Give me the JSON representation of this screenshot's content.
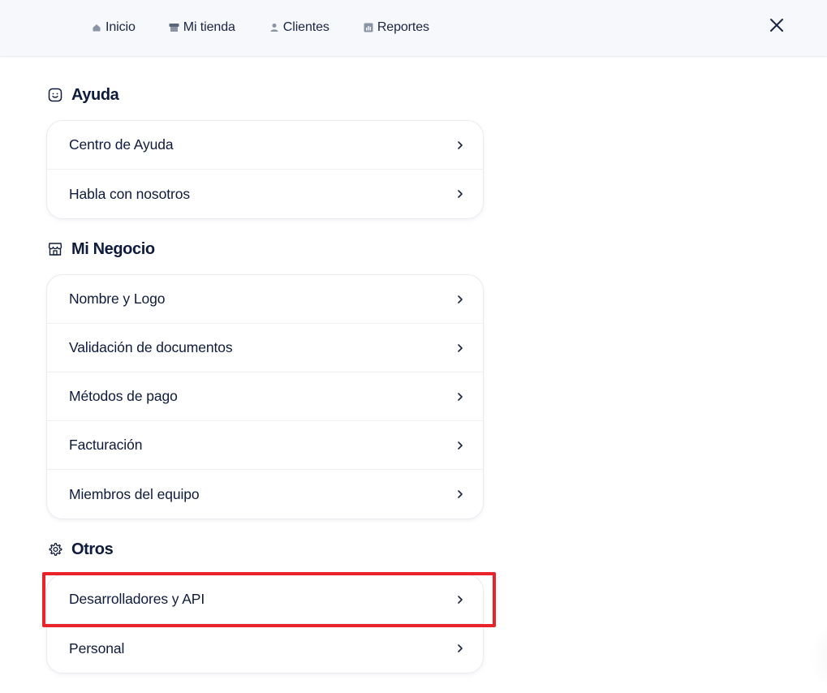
{
  "nav": {
    "items": [
      {
        "label": "Inicio",
        "icon": "home-icon"
      },
      {
        "label": "Mi tienda",
        "icon": "store-icon"
      },
      {
        "label": "Clientes",
        "icon": "users-icon"
      },
      {
        "label": "Reportes",
        "icon": "chart-icon"
      }
    ],
    "close_icon": "close-icon"
  },
  "sections": [
    {
      "title": "Ayuda",
      "icon": "smile-icon",
      "items": [
        "Centro de Ayuda",
        "Habla con nosotros"
      ]
    },
    {
      "title": "Mi Negocio",
      "icon": "storefront-icon",
      "items": [
        "Nombre y Logo",
        "Validación de documentos",
        "Métodos de pago",
        "Facturación",
        "Miembros del equipo"
      ]
    },
    {
      "title": "Otros",
      "icon": "gear-icon",
      "items": [
        "Desarrolladores y API",
        "Personal"
      ]
    }
  ],
  "colors": {
    "text": "#0f1b3d",
    "topbar_bg": "#f7f8fb",
    "highlight": "#e8232a",
    "icon_gray": "#8a94a6"
  }
}
